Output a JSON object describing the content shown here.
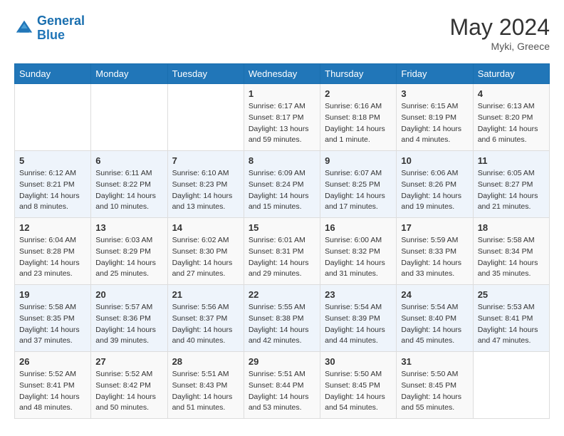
{
  "header": {
    "logo_line1": "General",
    "logo_line2": "Blue",
    "month_year": "May 2024",
    "location": "Myki, Greece"
  },
  "weekdays": [
    "Sunday",
    "Monday",
    "Tuesday",
    "Wednesday",
    "Thursday",
    "Friday",
    "Saturday"
  ],
  "weeks": [
    [
      {
        "day": "",
        "sunrise": "",
        "sunset": "",
        "daylight": ""
      },
      {
        "day": "",
        "sunrise": "",
        "sunset": "",
        "daylight": ""
      },
      {
        "day": "",
        "sunrise": "",
        "sunset": "",
        "daylight": ""
      },
      {
        "day": "1",
        "sunrise": "Sunrise: 6:17 AM",
        "sunset": "Sunset: 8:17 PM",
        "daylight": "Daylight: 13 hours and 59 minutes."
      },
      {
        "day": "2",
        "sunrise": "Sunrise: 6:16 AM",
        "sunset": "Sunset: 8:18 PM",
        "daylight": "Daylight: 14 hours and 1 minute."
      },
      {
        "day": "3",
        "sunrise": "Sunrise: 6:15 AM",
        "sunset": "Sunset: 8:19 PM",
        "daylight": "Daylight: 14 hours and 4 minutes."
      },
      {
        "day": "4",
        "sunrise": "Sunrise: 6:13 AM",
        "sunset": "Sunset: 8:20 PM",
        "daylight": "Daylight: 14 hours and 6 minutes."
      }
    ],
    [
      {
        "day": "5",
        "sunrise": "Sunrise: 6:12 AM",
        "sunset": "Sunset: 8:21 PM",
        "daylight": "Daylight: 14 hours and 8 minutes."
      },
      {
        "day": "6",
        "sunrise": "Sunrise: 6:11 AM",
        "sunset": "Sunset: 8:22 PM",
        "daylight": "Daylight: 14 hours and 10 minutes."
      },
      {
        "day": "7",
        "sunrise": "Sunrise: 6:10 AM",
        "sunset": "Sunset: 8:23 PM",
        "daylight": "Daylight: 14 hours and 13 minutes."
      },
      {
        "day": "8",
        "sunrise": "Sunrise: 6:09 AM",
        "sunset": "Sunset: 8:24 PM",
        "daylight": "Daylight: 14 hours and 15 minutes."
      },
      {
        "day": "9",
        "sunrise": "Sunrise: 6:07 AM",
        "sunset": "Sunset: 8:25 PM",
        "daylight": "Daylight: 14 hours and 17 minutes."
      },
      {
        "day": "10",
        "sunrise": "Sunrise: 6:06 AM",
        "sunset": "Sunset: 8:26 PM",
        "daylight": "Daylight: 14 hours and 19 minutes."
      },
      {
        "day": "11",
        "sunrise": "Sunrise: 6:05 AM",
        "sunset": "Sunset: 8:27 PM",
        "daylight": "Daylight: 14 hours and 21 minutes."
      }
    ],
    [
      {
        "day": "12",
        "sunrise": "Sunrise: 6:04 AM",
        "sunset": "Sunset: 8:28 PM",
        "daylight": "Daylight: 14 hours and 23 minutes."
      },
      {
        "day": "13",
        "sunrise": "Sunrise: 6:03 AM",
        "sunset": "Sunset: 8:29 PM",
        "daylight": "Daylight: 14 hours and 25 minutes."
      },
      {
        "day": "14",
        "sunrise": "Sunrise: 6:02 AM",
        "sunset": "Sunset: 8:30 PM",
        "daylight": "Daylight: 14 hours and 27 minutes."
      },
      {
        "day": "15",
        "sunrise": "Sunrise: 6:01 AM",
        "sunset": "Sunset: 8:31 PM",
        "daylight": "Daylight: 14 hours and 29 minutes."
      },
      {
        "day": "16",
        "sunrise": "Sunrise: 6:00 AM",
        "sunset": "Sunset: 8:32 PM",
        "daylight": "Daylight: 14 hours and 31 minutes."
      },
      {
        "day": "17",
        "sunrise": "Sunrise: 5:59 AM",
        "sunset": "Sunset: 8:33 PM",
        "daylight": "Daylight: 14 hours and 33 minutes."
      },
      {
        "day": "18",
        "sunrise": "Sunrise: 5:58 AM",
        "sunset": "Sunset: 8:34 PM",
        "daylight": "Daylight: 14 hours and 35 minutes."
      }
    ],
    [
      {
        "day": "19",
        "sunrise": "Sunrise: 5:58 AM",
        "sunset": "Sunset: 8:35 PM",
        "daylight": "Daylight: 14 hours and 37 minutes."
      },
      {
        "day": "20",
        "sunrise": "Sunrise: 5:57 AM",
        "sunset": "Sunset: 8:36 PM",
        "daylight": "Daylight: 14 hours and 39 minutes."
      },
      {
        "day": "21",
        "sunrise": "Sunrise: 5:56 AM",
        "sunset": "Sunset: 8:37 PM",
        "daylight": "Daylight: 14 hours and 40 minutes."
      },
      {
        "day": "22",
        "sunrise": "Sunrise: 5:55 AM",
        "sunset": "Sunset: 8:38 PM",
        "daylight": "Daylight: 14 hours and 42 minutes."
      },
      {
        "day": "23",
        "sunrise": "Sunrise: 5:54 AM",
        "sunset": "Sunset: 8:39 PM",
        "daylight": "Daylight: 14 hours and 44 minutes."
      },
      {
        "day": "24",
        "sunrise": "Sunrise: 5:54 AM",
        "sunset": "Sunset: 8:40 PM",
        "daylight": "Daylight: 14 hours and 45 minutes."
      },
      {
        "day": "25",
        "sunrise": "Sunrise: 5:53 AM",
        "sunset": "Sunset: 8:41 PM",
        "daylight": "Daylight: 14 hours and 47 minutes."
      }
    ],
    [
      {
        "day": "26",
        "sunrise": "Sunrise: 5:52 AM",
        "sunset": "Sunset: 8:41 PM",
        "daylight": "Daylight: 14 hours and 48 minutes."
      },
      {
        "day": "27",
        "sunrise": "Sunrise: 5:52 AM",
        "sunset": "Sunset: 8:42 PM",
        "daylight": "Daylight: 14 hours and 50 minutes."
      },
      {
        "day": "28",
        "sunrise": "Sunrise: 5:51 AM",
        "sunset": "Sunset: 8:43 PM",
        "daylight": "Daylight: 14 hours and 51 minutes."
      },
      {
        "day": "29",
        "sunrise": "Sunrise: 5:51 AM",
        "sunset": "Sunset: 8:44 PM",
        "daylight": "Daylight: 14 hours and 53 minutes."
      },
      {
        "day": "30",
        "sunrise": "Sunrise: 5:50 AM",
        "sunset": "Sunset: 8:45 PM",
        "daylight": "Daylight: 14 hours and 54 minutes."
      },
      {
        "day": "31",
        "sunrise": "Sunrise: 5:50 AM",
        "sunset": "Sunset: 8:45 PM",
        "daylight": "Daylight: 14 hours and 55 minutes."
      },
      {
        "day": "",
        "sunrise": "",
        "sunset": "",
        "daylight": ""
      }
    ]
  ]
}
